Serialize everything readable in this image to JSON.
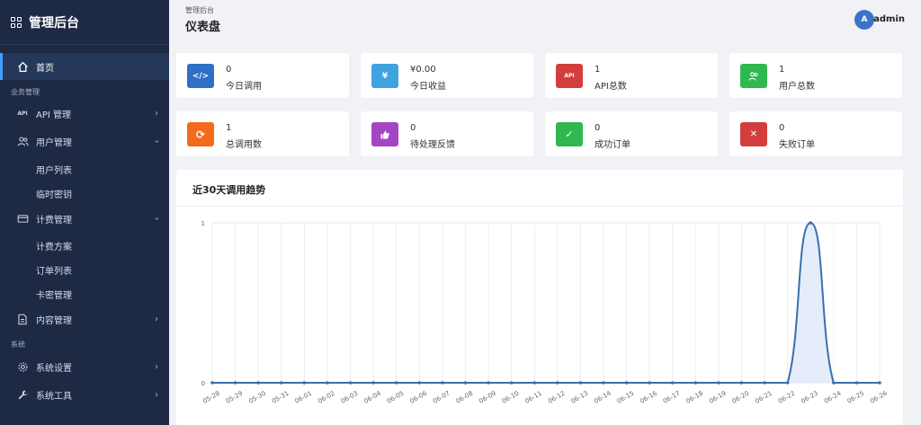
{
  "sidebar": {
    "brand": "管理后台",
    "items": {
      "home": "首页",
      "group_business": "业务管理",
      "api": "API 管理",
      "users": "用户管理",
      "user_list": "用户列表",
      "temp_keys": "临时密钥",
      "billing": "计费管理",
      "plans": "计费方案",
      "orders": "订单列表",
      "card_keys": "卡密管理",
      "content": "内容管理",
      "group_system": "系统",
      "settings": "系统设置",
      "tools": "系统工具"
    },
    "icons": {
      "home": "home-icon",
      "api": "api-icon",
      "users": "users-icon",
      "billing": "card-icon",
      "content": "document-icon",
      "settings": "gear-icon",
      "tools": "wrench-icon"
    }
  },
  "header": {
    "breadcrumb": "管理后台",
    "title": "仪表盘",
    "avatar_initial": "A",
    "username": "admin"
  },
  "stats": [
    {
      "value": "0",
      "label": "今日调用",
      "color": "#2f6fc6",
      "icon": "code-icon",
      "glyph": "</>"
    },
    {
      "value": "¥0.00",
      "label": "今日收益",
      "color": "#41a2e0",
      "icon": "yen-icon",
      "glyph": "¥"
    },
    {
      "value": "1",
      "label": "API总数",
      "color": "#d43d3d",
      "icon": "api-icon",
      "glyph": "API"
    },
    {
      "value": "1",
      "label": "用户总数",
      "color": "#2eb84f",
      "icon": "users-icon",
      "glyph": "👥"
    },
    {
      "value": "1",
      "label": "总调用数",
      "color": "#f26b1d",
      "icon": "refresh-icon",
      "glyph": "⟳"
    },
    {
      "value": "0",
      "label": "待处理反馈",
      "color": "#a445c4",
      "icon": "thumbs-up-icon",
      "glyph": "👍"
    },
    {
      "value": "0",
      "label": "成功订单",
      "color": "#2eb84f",
      "icon": "check-icon",
      "glyph": "✓"
    },
    {
      "value": "0",
      "label": "失败订单",
      "color": "#d43d3d",
      "icon": "close-icon",
      "glyph": "✕"
    }
  ],
  "chart": {
    "title": "近30天调用趋势"
  },
  "chart_data": {
    "type": "area",
    "title": "近30天调用趋势",
    "categories": [
      "05-28",
      "05-29",
      "05-30",
      "05-31",
      "06-01",
      "06-02",
      "06-03",
      "06-04",
      "06-05",
      "06-06",
      "06-07",
      "06-08",
      "06-09",
      "06-10",
      "06-11",
      "06-12",
      "06-13",
      "06-14",
      "06-15",
      "06-16",
      "06-17",
      "06-18",
      "06-19",
      "06-20",
      "06-21",
      "06-22",
      "06-23",
      "06-24",
      "06-25",
      "06-26"
    ],
    "values": [
      0,
      0,
      0,
      0,
      0,
      0,
      0,
      0,
      0,
      0,
      0,
      0,
      0,
      0,
      0,
      0,
      0,
      0,
      0,
      0,
      0,
      0,
      0,
      0,
      0,
      0,
      1,
      0,
      0,
      0
    ],
    "ylim": [
      0,
      1
    ],
    "yticks": [
      "0",
      "1"
    ],
    "line_color": "#3a6fb0",
    "fill_color": "#dde9f7",
    "grid": true
  }
}
